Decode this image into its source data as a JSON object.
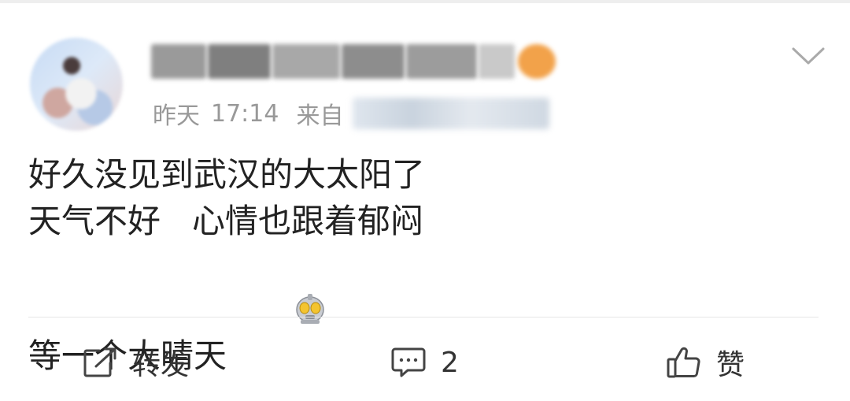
{
  "post": {
    "author": {
      "name": "████████████",
      "name_obscured": true
    },
    "meta": {
      "date": "昨天",
      "time": "17:14",
      "source_prefix": "来自",
      "source_obscured": true
    },
    "text_lines": [
      "好久没见到武汉的大太阳了",
      "天气不好   心情也跟着郁闷",
      "等一个大晴天"
    ],
    "emoji": "robot-emoji"
  },
  "actions": {
    "repost_label": "转发",
    "comment_count": "2",
    "like_label": "赞"
  },
  "icons": {
    "expand": "chevron-down-icon",
    "repost": "repost-icon",
    "comment": "comment-icon",
    "like": "thumbs-up-icon"
  },
  "colors": {
    "text_primary": "#222222",
    "text_secondary": "#999999",
    "divider": "#e6e6e6"
  }
}
